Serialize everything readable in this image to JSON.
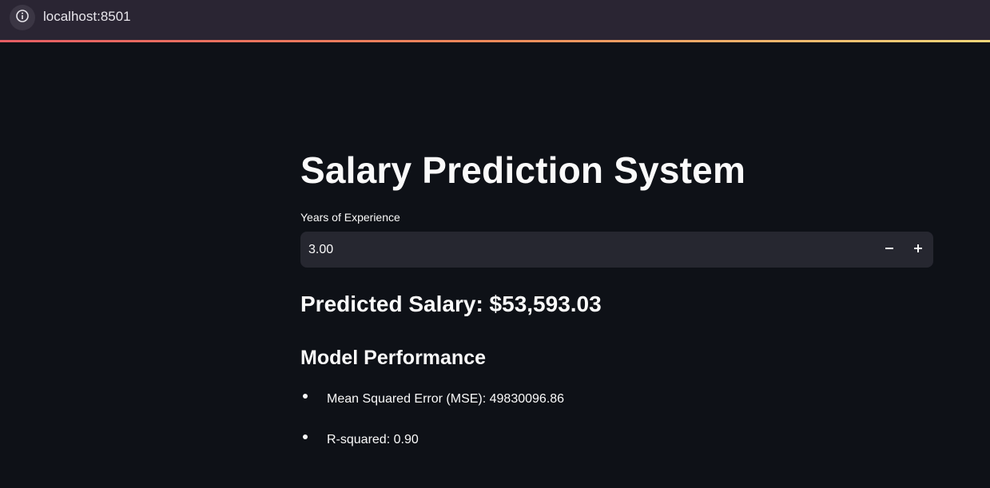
{
  "browser": {
    "url": "localhost:8501",
    "info_icon": "info-icon"
  },
  "colors": {
    "page_background": "#0e1117",
    "browser_bar": "#2a2533",
    "input_background": "#262730",
    "text": "#fafafa",
    "accent_gradient": [
      "#e45d63",
      "#f08a5a",
      "#f5d77a"
    ]
  },
  "app": {
    "title": "Salary Prediction System",
    "experience_input": {
      "label": "Years of Experience",
      "value": "3.00",
      "decrement_icon": "minus-icon",
      "increment_icon": "plus-icon"
    },
    "prediction": "Predicted Salary: $53,593.03",
    "performance": {
      "heading": "Model Performance",
      "metrics": [
        {
          "text": "Mean Squared Error (MSE): 49830096.86"
        },
        {
          "text": "R-squared: 0.90"
        }
      ]
    }
  }
}
